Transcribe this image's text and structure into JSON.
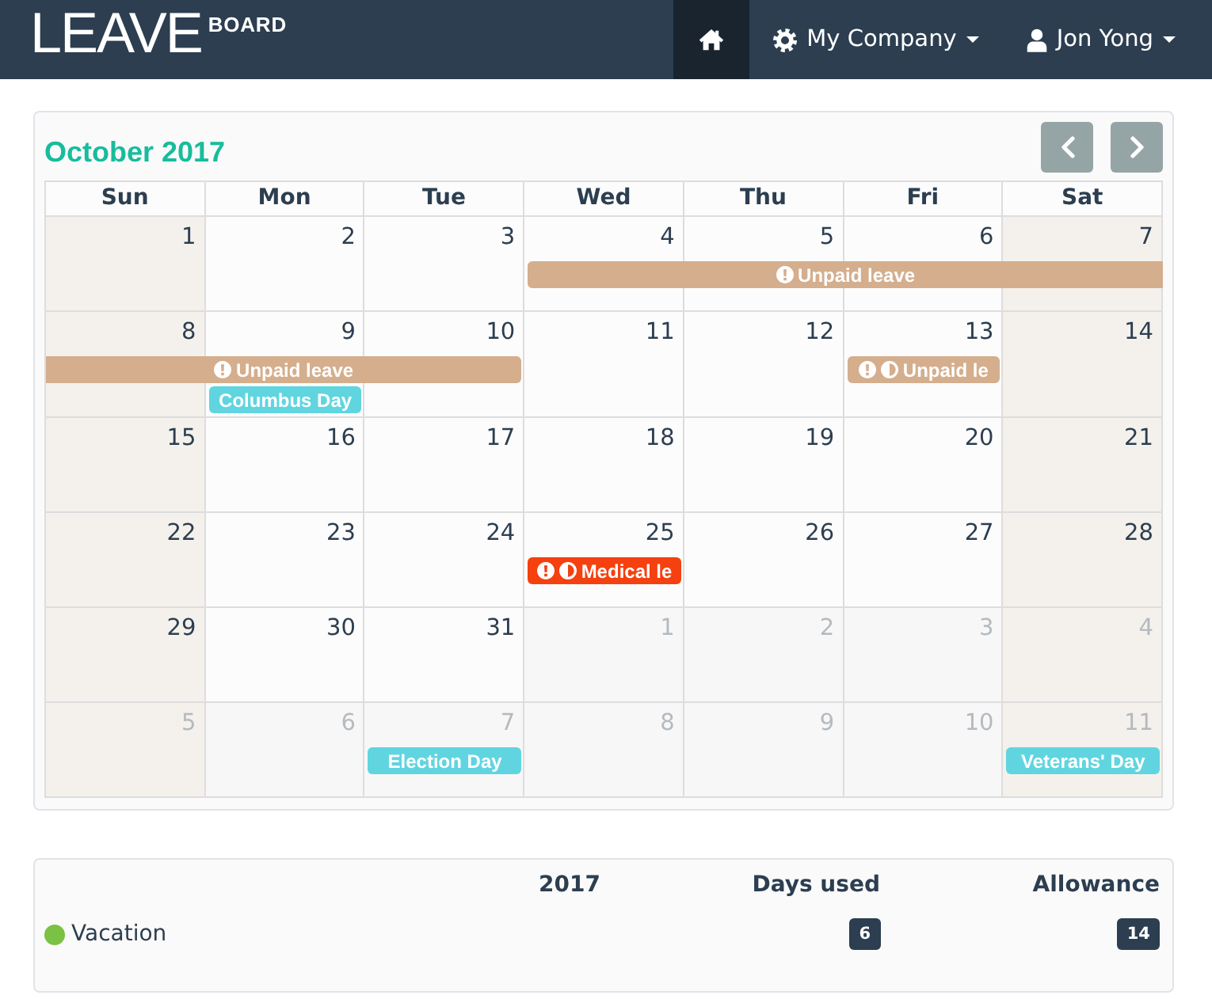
{
  "navbar": {
    "logo": {
      "main": "LEAVE",
      "sub": "BOARD"
    },
    "items": [
      {
        "kind": "home",
        "selected": true,
        "dropdown": false
      },
      {
        "kind": "company",
        "label": "My Company",
        "selected": false,
        "dropdown": true
      },
      {
        "kind": "user",
        "label": "Jon Yong",
        "selected": false,
        "dropdown": true
      }
    ]
  },
  "calendar": {
    "title": "October 2017",
    "nav": [
      {
        "kind": "prev"
      },
      {
        "kind": "next"
      }
    ],
    "columns": [
      {
        "label": "Sun",
        "weekend": true
      },
      {
        "label": "Mon",
        "weekend": false
      },
      {
        "label": "Tue",
        "weekend": false
      },
      {
        "label": "Wed",
        "weekend": false
      },
      {
        "label": "Thu",
        "weekend": false
      },
      {
        "label": "Fri",
        "weekend": false
      },
      {
        "label": "Sat",
        "weekend": true
      }
    ],
    "weeks": [
      {
        "days": [
          {
            "label": "1",
            "other_month": false
          },
          {
            "label": "2",
            "other_month": false
          },
          {
            "label": "3",
            "other_month": false
          },
          {
            "label": "4",
            "other_month": false
          },
          {
            "label": "5",
            "other_month": false
          },
          {
            "label": "6",
            "other_month": false
          },
          {
            "label": "7",
            "other_month": false
          }
        ],
        "lanes": [
          [
            {
              "kind": "empty"
            },
            {
              "kind": "empty"
            },
            {
              "kind": "empty"
            },
            {
              "kind": "head",
              "text": "Unpaid leave",
              "color": "#d4ae8d",
              "pending": true,
              "half_day": false
            },
            {
              "kind": "more"
            },
            {
              "kind": "more"
            },
            {
              "kind": "more"
            }
          ]
        ]
      },
      {
        "days": [
          {
            "label": "8",
            "other_month": false
          },
          {
            "label": "9",
            "other_month": false
          },
          {
            "label": "10",
            "other_month": false
          },
          {
            "label": "11",
            "other_month": false
          },
          {
            "label": "12",
            "other_month": false
          },
          {
            "label": "13",
            "other_month": false
          },
          {
            "label": "14",
            "other_month": false
          }
        ],
        "lanes": [
          [
            {
              "kind": "tail",
              "text": "Unpaid leave",
              "color": "#d4ae8d",
              "pending": true,
              "half_day": false
            },
            {
              "kind": "more"
            },
            {
              "kind": "more"
            },
            {
              "kind": "empty"
            },
            {
              "kind": "empty"
            },
            {
              "kind": "bar",
              "text": "Unpaid le",
              "color": "#d4ae8d",
              "pending": true,
              "half_day": true
            },
            {
              "kind": "empty"
            }
          ],
          [
            {
              "kind": "empty"
            },
            {
              "kind": "bar",
              "text": "Columbus Day",
              "color": "#60d5e0",
              "pending": false,
              "half_day": false
            },
            {
              "kind": "empty"
            },
            {
              "kind": "empty"
            },
            {
              "kind": "empty"
            },
            {
              "kind": "empty"
            },
            {
              "kind": "empty"
            }
          ]
        ]
      },
      {
        "days": [
          {
            "label": "15",
            "other_month": false
          },
          {
            "label": "16",
            "other_month": false
          },
          {
            "label": "17",
            "other_month": false
          },
          {
            "label": "18",
            "other_month": false
          },
          {
            "label": "19",
            "other_month": false
          },
          {
            "label": "20",
            "other_month": false
          },
          {
            "label": "21",
            "other_month": false
          }
        ]
      },
      {
        "days": [
          {
            "label": "22",
            "other_month": false
          },
          {
            "label": "23",
            "other_month": false
          },
          {
            "label": "24",
            "other_month": false
          },
          {
            "label": "25",
            "other_month": false
          },
          {
            "label": "26",
            "other_month": false
          },
          {
            "label": "27",
            "other_month": false
          },
          {
            "label": "28",
            "other_month": false
          }
        ],
        "lanes": [
          [
            {
              "kind": "empty"
            },
            {
              "kind": "empty"
            },
            {
              "kind": "empty"
            },
            {
              "kind": "bar",
              "text": "Medical le",
              "color": "#f5400f",
              "pending": true,
              "half_day": true
            },
            {
              "kind": "empty"
            },
            {
              "kind": "empty"
            },
            {
              "kind": "empty"
            }
          ]
        ]
      },
      {
        "days": [
          {
            "label": "29",
            "other_month": false
          },
          {
            "label": "30",
            "other_month": false
          },
          {
            "label": "31",
            "other_month": false
          },
          {
            "label": "1",
            "other_month": true
          },
          {
            "label": "2",
            "other_month": true
          },
          {
            "label": "3",
            "other_month": true
          },
          {
            "label": "4",
            "other_month": true
          }
        ]
      },
      {
        "days": [
          {
            "label": "5",
            "other_month": true
          },
          {
            "label": "6",
            "other_month": true
          },
          {
            "label": "7",
            "other_month": true
          },
          {
            "label": "8",
            "other_month": true
          },
          {
            "label": "9",
            "other_month": true
          },
          {
            "label": "10",
            "other_month": true
          },
          {
            "label": "11",
            "other_month": true
          }
        ],
        "lanes": [
          [
            {
              "kind": "empty"
            },
            {
              "kind": "empty"
            },
            {
              "kind": "bar",
              "text": "Election Day",
              "color": "#60d5e0",
              "pending": false,
              "half_day": false
            },
            {
              "kind": "empty"
            },
            {
              "kind": "empty"
            },
            {
              "kind": "empty"
            },
            {
              "kind": "bar",
              "text": "Veterans' Day",
              "color": "#60d5e0",
              "pending": false,
              "half_day": false
            }
          ]
        ]
      }
    ]
  },
  "summary": {
    "headers": [
      "2017",
      "Days used",
      "Allowance"
    ],
    "rows": [
      {
        "name": "Vacation",
        "color": "#7bc143",
        "days_used": "6",
        "allowance": "14"
      }
    ]
  }
}
